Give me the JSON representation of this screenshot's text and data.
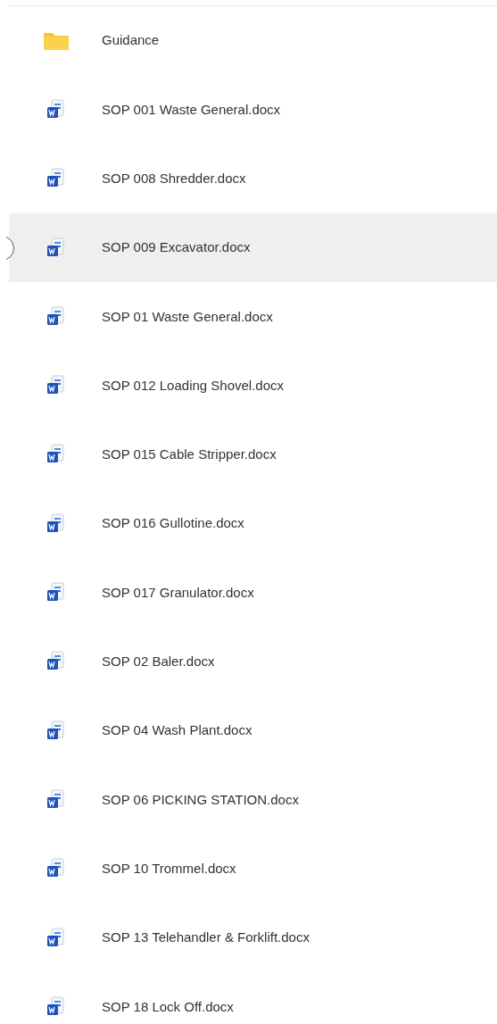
{
  "files": [
    {
      "kind": "folder",
      "name": "Guidance",
      "hovered": false
    },
    {
      "kind": "word",
      "name": "SOP 001 Waste General.docx",
      "hovered": false
    },
    {
      "kind": "word",
      "name": "SOP 008 Shredder.docx",
      "hovered": false
    },
    {
      "kind": "word",
      "name": "SOP 009 Excavator.docx",
      "hovered": true
    },
    {
      "kind": "word",
      "name": "SOP 01 Waste General.docx",
      "hovered": false
    },
    {
      "kind": "word",
      "name": "SOP 012 Loading Shovel.docx",
      "hovered": false
    },
    {
      "kind": "word",
      "name": "SOP 015 Cable Stripper.docx",
      "hovered": false
    },
    {
      "kind": "word",
      "name": "SOP 016 Gullotine.docx",
      "hovered": false
    },
    {
      "kind": "word",
      "name": "SOP 017 Granulator.docx",
      "hovered": false
    },
    {
      "kind": "word",
      "name": "SOP 02 Baler.docx",
      "hovered": false
    },
    {
      "kind": "word",
      "name": "SOP 04 Wash Plant.docx",
      "hovered": false
    },
    {
      "kind": "word",
      "name": "SOP 06 PICKING STATION.docx",
      "hovered": false
    },
    {
      "kind": "word",
      "name": "SOP 10 Trommel.docx",
      "hovered": false
    },
    {
      "kind": "word",
      "name": "SOP 13 Telehandler & Forklift.docx",
      "hovered": false
    },
    {
      "kind": "word",
      "name": "SOP 18 Lock Off.docx",
      "hovered": false
    }
  ]
}
